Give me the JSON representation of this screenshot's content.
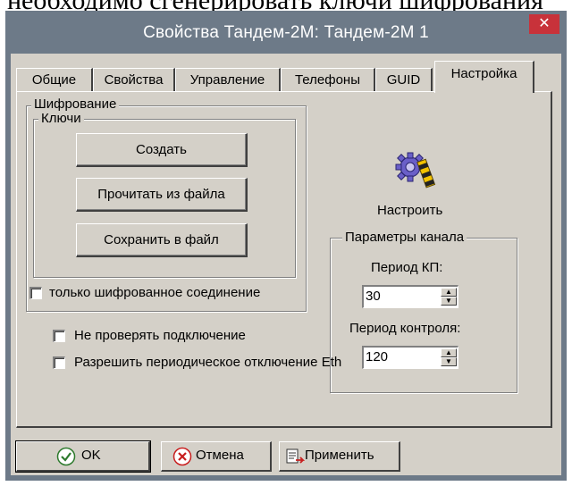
{
  "document": {
    "fragment": "необходимо сгенерировать ключи шифрования"
  },
  "window": {
    "title": "Свойства Тандем-2М: Тандем-2М 1",
    "close_glyph": "✕"
  },
  "tabs": [
    {
      "label": "Общие"
    },
    {
      "label": "Свойства"
    },
    {
      "label": "Управление"
    },
    {
      "label": "Телефоны"
    },
    {
      "label": "GUID"
    },
    {
      "label": "Настройка",
      "active": true
    }
  ],
  "encryption": {
    "group_label": "Шифрование",
    "keys": {
      "group_label": "Ключи",
      "create_button": "Создать",
      "read_button": "Прочитать из файла",
      "save_button": "Сохранить  в  файл"
    },
    "only_encrypted_label": "только шифрованное соединение",
    "only_encrypted_checked": false
  },
  "configure": {
    "label": "Настроить",
    "icon": "gear-pencil-icon"
  },
  "channel_params": {
    "group_label": "Параметры канала",
    "period_kp_label": "Период КП:",
    "period_kp_value": "30",
    "period_control_label": "Период контроля:",
    "period_control_value": "120"
  },
  "options": {
    "no_check_connection_label": "Не проверять подключение",
    "no_check_connection_checked": false,
    "allow_eth_disconnect_label": "Разрешить периодическое отключение  Eth",
    "allow_eth_disconnect_checked": false
  },
  "buttons": {
    "ok_label": "OK",
    "cancel_label": "Отмена",
    "apply_label": "Применить"
  },
  "colors": {
    "titlebar": "#6d7a88",
    "dialog_bg": "#d4d0c8",
    "close_button": "#c8323a"
  }
}
